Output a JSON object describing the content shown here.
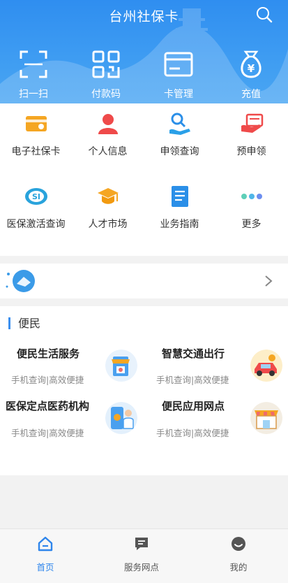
{
  "header": {
    "title": "台州社保卡",
    "quick": [
      {
        "label": "扫一扫",
        "icon": "scan-icon"
      },
      {
        "label": "付款码",
        "icon": "qr-code-icon"
      },
      {
        "label": "卡管理",
        "icon": "card-icon"
      },
      {
        "label": "充值",
        "icon": "money-bag-icon"
      }
    ]
  },
  "grid": [
    {
      "label": "电子社保卡",
      "icon": "e-card-icon"
    },
    {
      "label": "个人信息",
      "icon": "person-icon"
    },
    {
      "label": "申领查询",
      "icon": "apply-search-icon"
    },
    {
      "label": "预申领",
      "icon": "pre-apply-icon"
    },
    {
      "label": "医保激活查询",
      "icon": "si-logo-icon"
    },
    {
      "label": "人才市场",
      "icon": "graduation-cap-icon"
    },
    {
      "label": "业务指南",
      "icon": "document-icon"
    },
    {
      "label": "更多",
      "icon": "more-dots-icon"
    }
  ],
  "section": {
    "title": "便民",
    "items": [
      {
        "title": "便民生活服务",
        "subtitle": "手机查询|高效便捷",
        "icon": "shop-icon"
      },
      {
        "title": "智慧交通出行",
        "subtitle": "手机查询|高效便捷",
        "icon": "car-icon"
      },
      {
        "title": "医保定点医药机构",
        "subtitle": "手机查询|高效便捷",
        "icon": "doctor-phone-icon"
      },
      {
        "title": "便民应用网点",
        "subtitle": "手机查询|高效便捷",
        "icon": "store-icon"
      }
    ]
  },
  "tabs": [
    {
      "label": "首页",
      "icon": "home-icon",
      "active": true
    },
    {
      "label": "服务网点",
      "icon": "service-point-icon",
      "active": false
    },
    {
      "label": "我的",
      "icon": "profile-icon",
      "active": false
    }
  ],
  "colors": {
    "primary": "#3b8fef",
    "active_tab": "#2f86ec",
    "inactive_tab": "#555555"
  }
}
